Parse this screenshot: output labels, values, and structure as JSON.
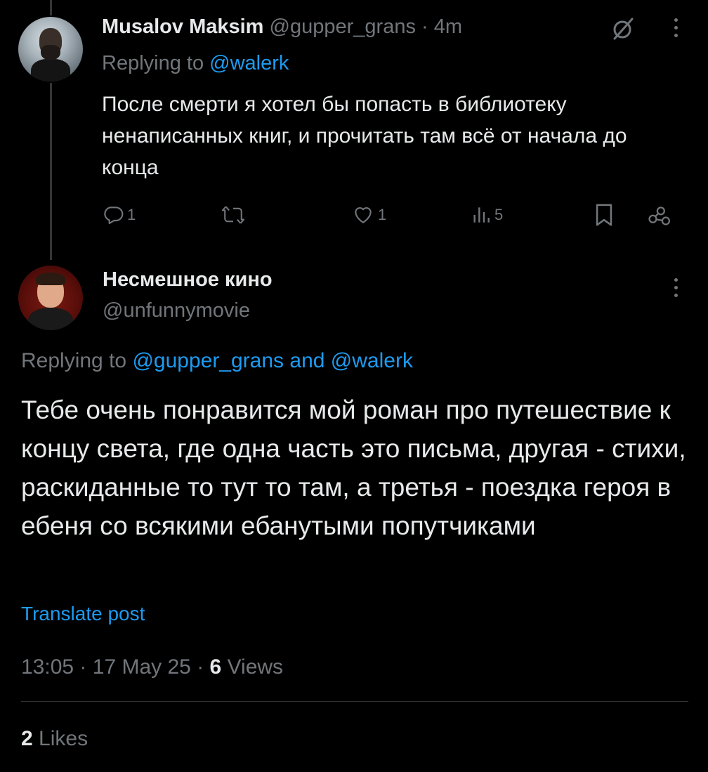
{
  "parent_tweet": {
    "author_name": "Musalov Maksim",
    "handle": "@gupper_grans",
    "separator": "·",
    "time": "4m",
    "replying_prefix": "Replying to",
    "replying_handle": "@walerk",
    "text": "После смерти я хотел бы попасть в библиотеку ненаписанных книг, и прочитать там всё от начала до конца",
    "actions": {
      "replies": "1",
      "retweets": "",
      "likes": "1",
      "views": "5"
    },
    "icons": [
      "grok-icon",
      "more-icon",
      "reply-icon",
      "retweet-icon",
      "like-icon",
      "views-icon",
      "bookmark-icon",
      "share-icon"
    ]
  },
  "main_tweet": {
    "author_name": "Несмешное кино",
    "handle": "@unfunnymovie",
    "replying_prefix": "Replying to",
    "replying_handle_1": "@gupper_grans",
    "replying_and": "and",
    "replying_handle_2": "@walerk",
    "text": "Тебе очень понравится мой роман про путешествие к концу света, где одна часть это письма, другая - стихи, раскиданные то тут то там, а третья - поездка героя в ебеня со всякими ебанутыми попутчиками",
    "translate_label": "Translate post",
    "time": "13:05",
    "date": "17 May 25",
    "separator": "·",
    "views_count": "6",
    "views_label": "Views",
    "likes_count": "2",
    "likes_label": "Likes"
  },
  "colors": {
    "background": "#000000",
    "text": "#e7e9ea",
    "secondary": "#71767b",
    "accent": "#1d9bf0",
    "divider": "#2f3336"
  }
}
